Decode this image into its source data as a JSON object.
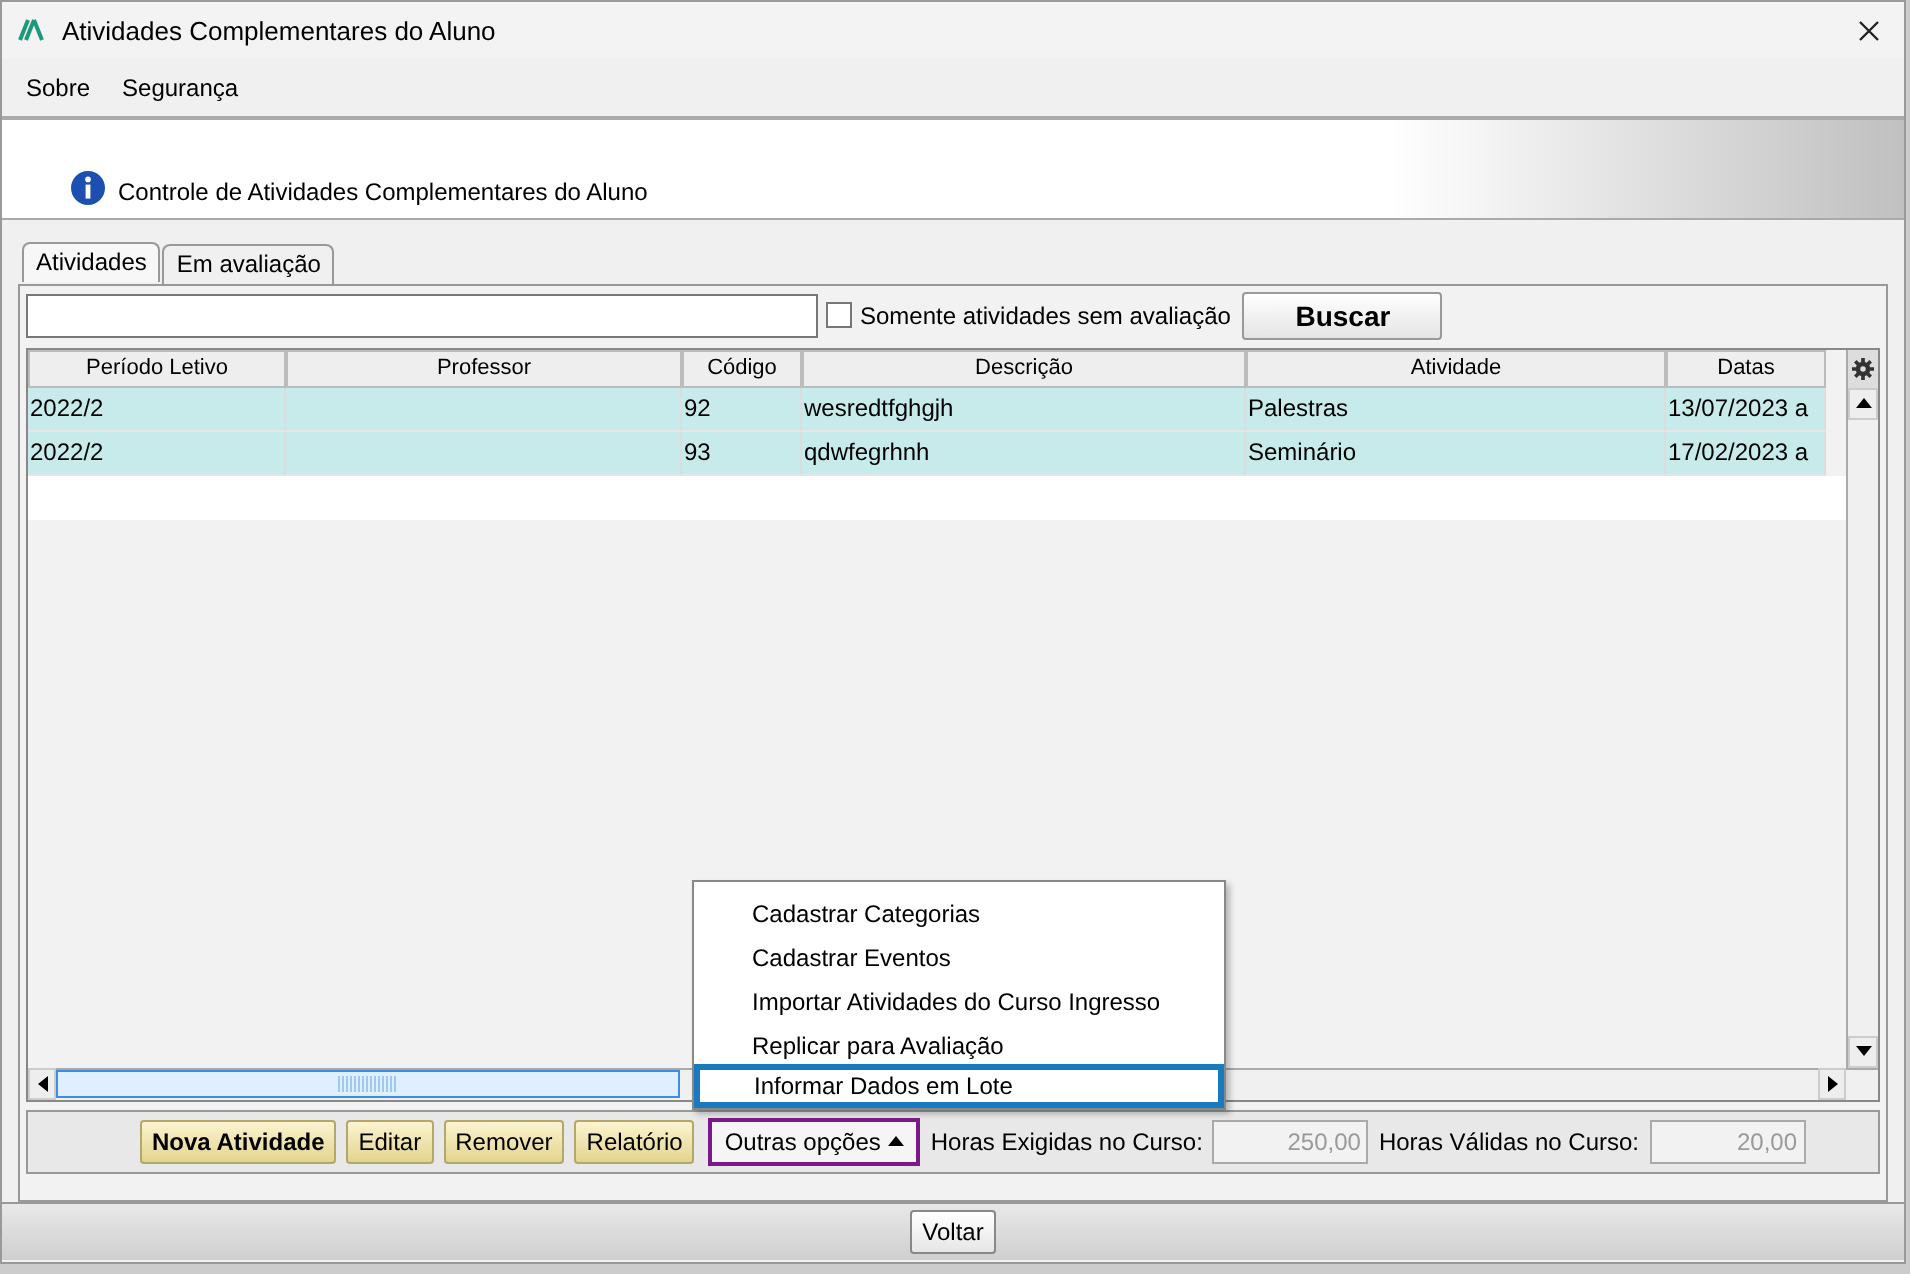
{
  "window": {
    "title": "Atividades Complementares do Aluno"
  },
  "menu": [
    "Sobre",
    "Segurança"
  ],
  "header": {
    "title": "Controle de Atividades Complementares do Aluno"
  },
  "tabs": [
    {
      "label": "Atividades",
      "selected": true
    },
    {
      "label": "Em avaliação",
      "selected": false
    }
  ],
  "search": {
    "only_without_evaluation": {
      "label": "Somente atividades sem avaliação",
      "checked": false
    },
    "button": "Buscar"
  },
  "table": {
    "columns": [
      "Período Letivo",
      "Professor",
      "Código",
      "Descrição",
      "Atividade",
      "Datas"
    ],
    "rows": [
      {
        "cells": [
          "2022/2",
          "",
          "92",
          "wesredtfghgjh",
          "Palestras",
          "13/07/2023 a"
        ],
        "selected": true
      },
      {
        "cells": [
          "2022/2",
          "",
          "93",
          "qdwfegrhnh",
          "Seminário",
          "17/02/2023 a"
        ],
        "selected": true
      }
    ]
  },
  "actions": [
    {
      "label": "Nova Atividade",
      "bold": true
    },
    {
      "label": "Editar",
      "bold": false
    },
    {
      "label": "Remover",
      "bold": false
    },
    {
      "label": "Relatório",
      "bold": false
    }
  ],
  "other_options": {
    "label": "Outras opções",
    "expanded": true,
    "items": [
      {
        "label": "Cadastrar Categorias",
        "selected": false
      },
      {
        "label": "Cadastrar Eventos",
        "selected": false
      },
      {
        "label": "Importar Atividades do Curso Ingresso",
        "selected": false
      },
      {
        "label": "Replicar para Avaliação",
        "selected": false
      },
      {
        "label": "Informar Dados em Lote",
        "selected": true
      }
    ]
  },
  "hours": [
    {
      "label": "Horas Exigidas no Curso:",
      "value": "250,00"
    },
    {
      "label": "Horas Válidas no Curso:",
      "value": "20,00"
    }
  ],
  "footer": {
    "button": "Voltar"
  }
}
